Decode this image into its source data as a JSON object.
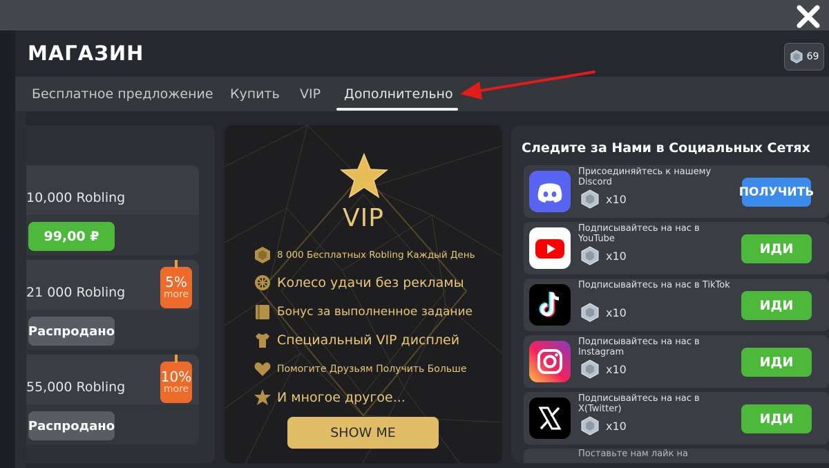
{
  "header": {
    "title": "МАГАЗИН",
    "currency_amount": "69"
  },
  "tabs": [
    {
      "label": "Бесплатное предложение"
    },
    {
      "label": "Купить"
    },
    {
      "label": "VIP"
    },
    {
      "label": "Дополнительно",
      "active": true
    }
  ],
  "left_offers": [
    {
      "amount": "10,000 Robling",
      "button": "99,00 ₽"
    },
    {
      "amount": "21 000 Robling",
      "button": "Распродано",
      "badge_pct": "5%",
      "badge_more": "more"
    },
    {
      "amount": "55,000 Robling",
      "button": "Распродано",
      "badge_pct": "10%",
      "badge_more": "more"
    }
  ],
  "vip": {
    "title": "VIP",
    "features": [
      "8 000 Бесплатных Robling Каждый День",
      "Колесо удачи без рекламы",
      "Бонус за выполненное задание",
      "Специальный VIP дисплей",
      "Помогите Друзьям Получить Больше",
      "И многое другое..."
    ],
    "button": "SHOW ME"
  },
  "social": {
    "title": "Следите за Нами в Социальных Сетях",
    "items": [
      {
        "text": "Присоединяйтесь к нашему Discord",
        "reward": "x10",
        "button": "ПОЛУЧИТЬ",
        "icon": "discord-icon"
      },
      {
        "text": "Подписывайтесь на нас в YouTube",
        "reward": "x10",
        "button": "ИДИ",
        "icon": "youtube-icon"
      },
      {
        "text": "Подписывайтесь на нас в TikTok",
        "reward": "x10",
        "button": "ИДИ",
        "icon": "tiktok-icon"
      },
      {
        "text": "Подписывайтесь на нас в Instagram",
        "reward": "x10",
        "button": "ИДИ",
        "icon": "instagram-icon"
      },
      {
        "text": "Подписывайтесь на нас в X(Twitter)",
        "reward": "x10",
        "button": "ИДИ",
        "icon": "x-twitter-icon"
      },
      {
        "text": "Поставьте нам лайк на"
      }
    ]
  },
  "colors": {
    "green": "#4cb93b",
    "blue": "#3b8bea",
    "gold": "#e8c778",
    "badge_orange": "#ec6a2a",
    "annotation_red": "#e21b1b"
  }
}
